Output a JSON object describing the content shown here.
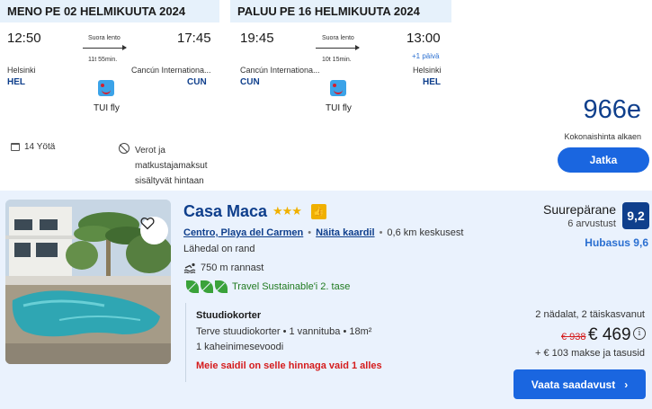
{
  "outbound": {
    "direction": "MENO",
    "date": "PE 02 HELMIKUUTA 2024",
    "depart_time": "12:50",
    "arrive_time": "17:45",
    "flight_type": "Suora lento",
    "duration": "11t 55min.",
    "from_city": "Helsinki",
    "from_code": "HEL",
    "to_city": "Cancún Internationa...",
    "to_code": "CUN",
    "airline": "TUI fly"
  },
  "return": {
    "direction": "PALUU",
    "date": "PE 16 HELMIKUUTA 2024",
    "depart_time": "19:45",
    "arrive_time": "13:00",
    "flight_type": "Suora lento",
    "duration": "10t 15min.",
    "plus_day": "+1 päivä",
    "from_city": "Cancún Internationa...",
    "from_code": "CUN",
    "to_city": "Helsinki",
    "to_code": "HEL",
    "airline": "TUI fly"
  },
  "summary": {
    "nights": "14 Yötä",
    "taxes": "Verot ja matkustajamaksut sisältyvät hintaan",
    "price": "966e",
    "price_caption": "Kokonaishinta alkaen",
    "continue_label": "Jatka"
  },
  "hotel": {
    "name": "Casa Maca",
    "stars": "★★★",
    "location_link": "Centro, Playa del Carmen",
    "map_link": "Näita kaardil",
    "distance": "0,6 km keskusest",
    "near_beach": "Lähedal on rand",
    "beach_distance": "750 m rannast",
    "sustainability": "Travel Sustainable'i 2. tase",
    "rating_word": "Suurepärane",
    "review_count": "6 arvustust",
    "rating_score": "9,2",
    "sub_rating": "Hubasus 9,6",
    "room_title": "Stuudiokorter",
    "room_details": "Terve stuudiokorter • 1 vannituba • 18m²",
    "room_bed": "1 kaheinimesevoodi",
    "room_alert": "Meie saidil on selle hinnaga vaid 1 alles",
    "stay_info": "2 nädalat, 2 täiskasvanut",
    "old_price": "€ 938",
    "new_price": "€ 469",
    "extra_fees": "+ € 103 makse ja tasusid",
    "availability_label": "Vaata saadavust"
  },
  "icons": {
    "calendar": "calendar-icon",
    "taxes": "no-tax-icon",
    "airline_logo": "tui-logo-icon",
    "heart": "heart-icon",
    "thumb": "thumbs-up-icon",
    "swim": "swimmer-icon",
    "leaf": "leaf-icon",
    "info": "info-icon",
    "chevron": "chevron-right-icon"
  },
  "colors": {
    "primary_blue": "#1a66e0",
    "dark_blue": "#0f3f8c",
    "header_bg": "#e6f1fb",
    "hotel_bg": "#eaf2fd",
    "star_yellow": "#f0b000",
    "alert_red": "#d51c1c",
    "sustain_green": "#3aa23a"
  }
}
